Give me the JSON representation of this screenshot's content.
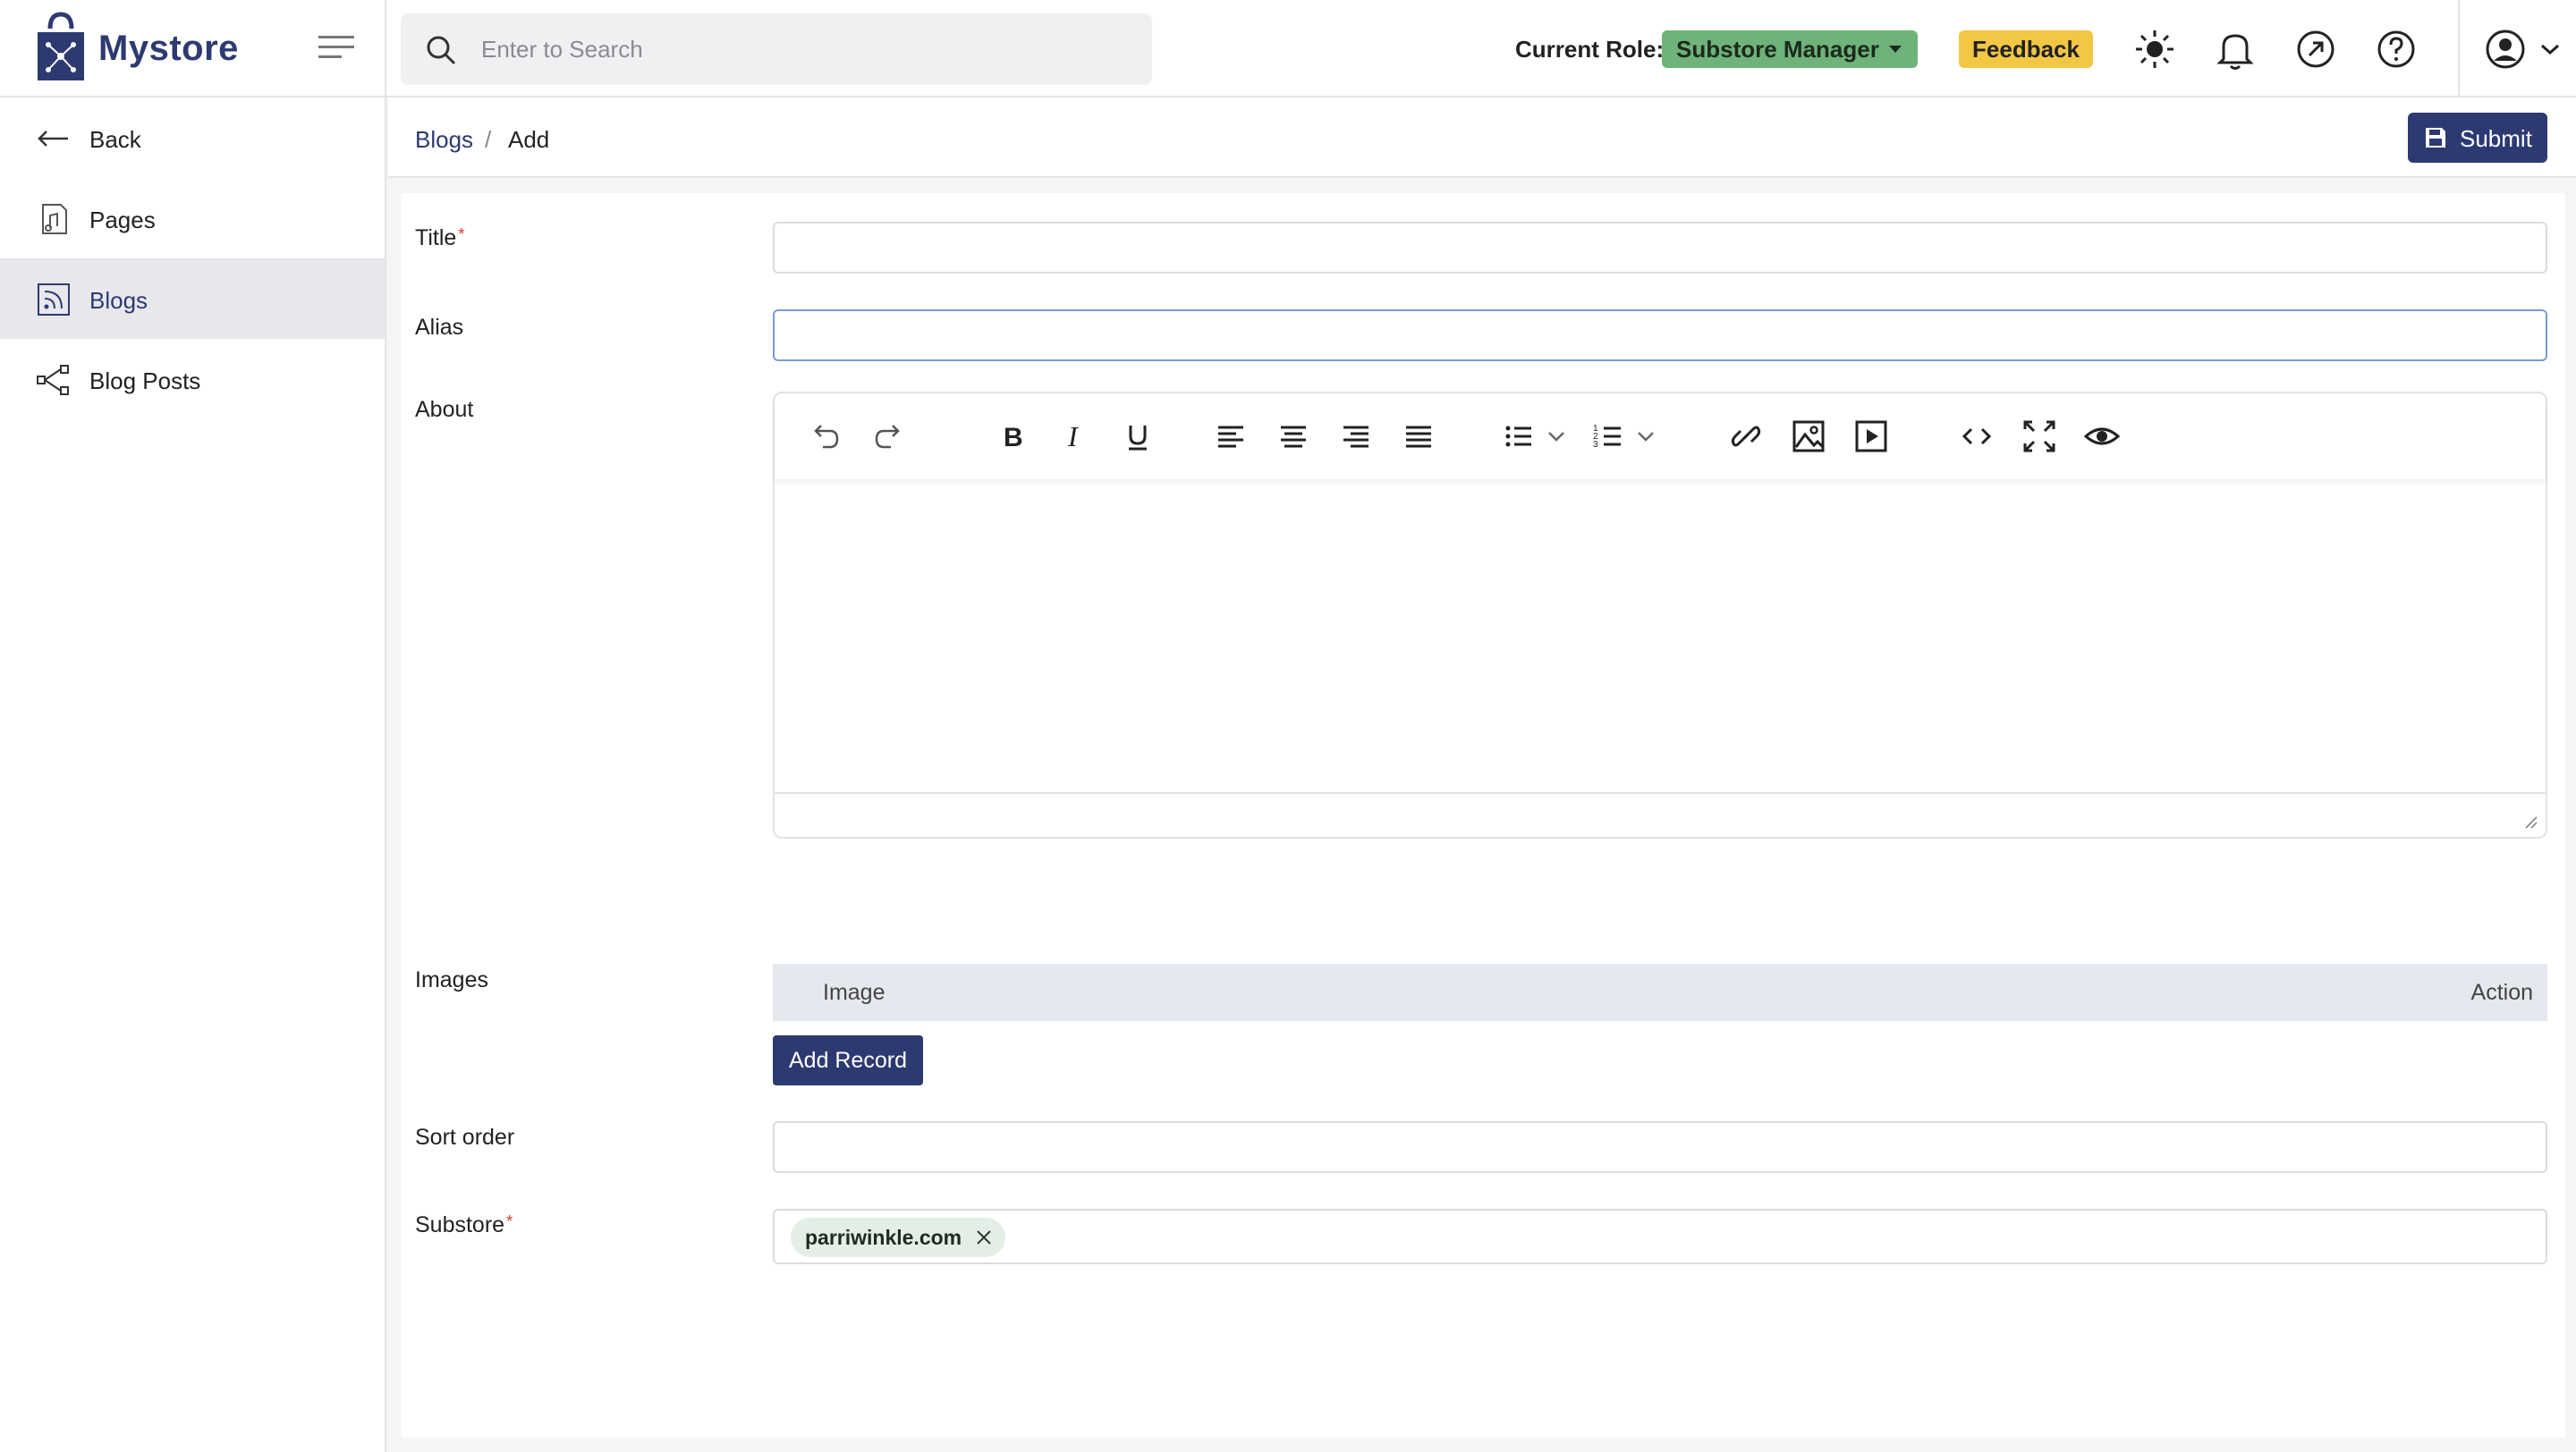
{
  "app": {
    "name": "Mystore",
    "brand_color": "#2d3a72"
  },
  "header": {
    "search_placeholder": "Enter to Search",
    "role_label": "Current Role:",
    "role_value": "Substore Manager",
    "feedback_label": "Feedback",
    "icons": [
      "sun-icon",
      "bell-icon",
      "external-link-icon",
      "help-icon",
      "user-avatar-icon",
      "chevron-down-icon"
    ]
  },
  "sidebar": {
    "items": [
      {
        "label": "Back",
        "icon": "arrow-left-icon",
        "active": false
      },
      {
        "label": "Pages",
        "icon": "page-icon",
        "active": false
      },
      {
        "label": "Blogs",
        "icon": "rss-icon",
        "active": true
      },
      {
        "label": "Blog Posts",
        "icon": "share-nodes-icon",
        "active": false
      }
    ]
  },
  "breadcrumb": {
    "parent": "Blogs",
    "separator": "/",
    "current": "Add"
  },
  "toolbar": {
    "submit_label": "Submit"
  },
  "form": {
    "title_label": "Title",
    "title_value": "",
    "alias_label": "Alias",
    "alias_value": "",
    "about_label": "About",
    "images_label": "Images",
    "images_columns": [
      "Image",
      "Action"
    ],
    "add_record_label": "Add Record",
    "sort_order_label": "Sort order",
    "sort_order_value": "",
    "substore_label": "Substore",
    "substore_chips": [
      "parriwinkle.com"
    ]
  },
  "colors": {
    "role_badge": "#6fb37a",
    "feedback": "#f2c744",
    "sidebar_active": "#e8e8ec",
    "table_head": "#e6e8ef",
    "chip": "#e3efe5"
  }
}
